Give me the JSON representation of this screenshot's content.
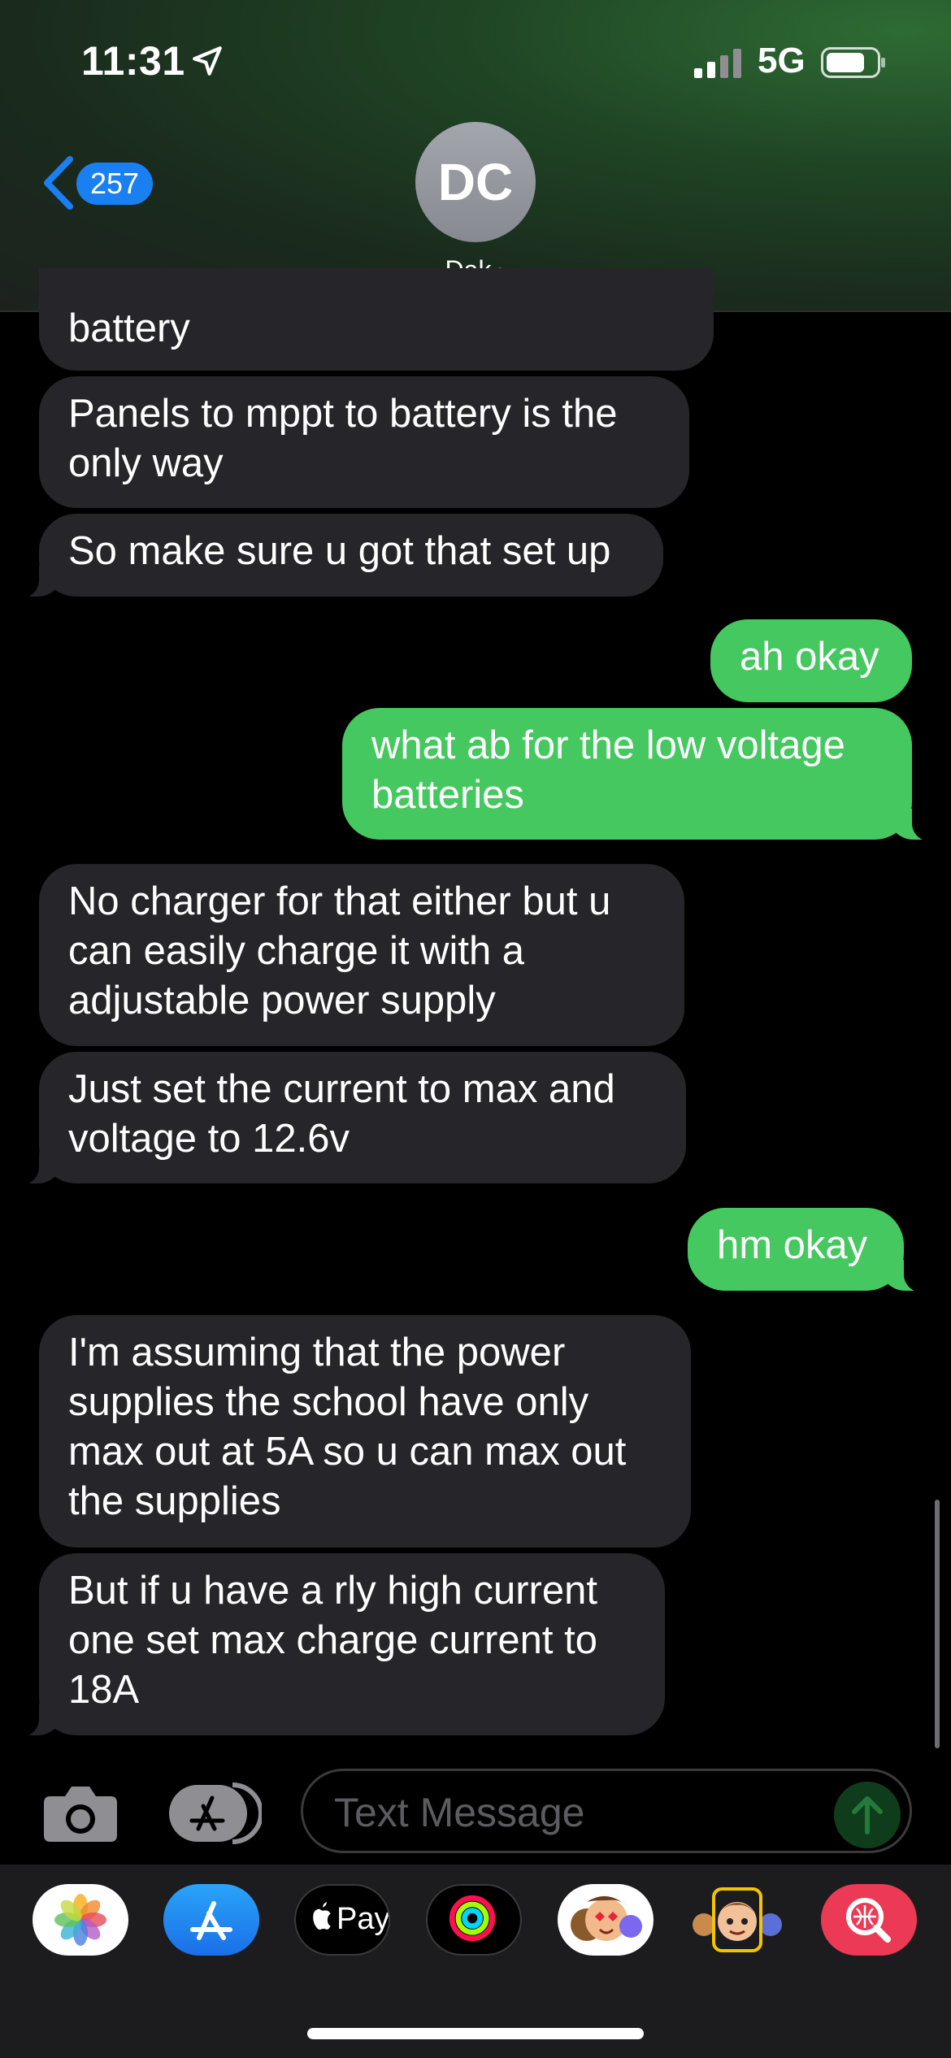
{
  "status_bar": {
    "time": "11:31",
    "network": "5G"
  },
  "header": {
    "back_count": "257",
    "avatar_initials": "DC",
    "contact_name": "Dak"
  },
  "messages": [
    {
      "direction": "incoming",
      "text": "battery"
    },
    {
      "direction": "incoming",
      "text": "Panels to mppt to battery is the\nonly way"
    },
    {
      "direction": "incoming",
      "text": "So make sure u got that set up"
    },
    {
      "direction": "outgoing",
      "text": "ah okay"
    },
    {
      "direction": "outgoing",
      "text": "what ab for the low voltage\nbatteries"
    },
    {
      "direction": "incoming",
      "text": "No charger for that either but u\ncan easily charge it with a\nadjustable power supply"
    },
    {
      "direction": "incoming",
      "text": "Just set the current to max and\nvoltage to 12.6v"
    },
    {
      "direction": "outgoing",
      "text": "hm okay"
    },
    {
      "direction": "incoming",
      "text": "I'm assuming that the power\nsupplies the school have only\nmax out at 5A so u can max out\nthe supplies"
    },
    {
      "direction": "incoming",
      "text": "But if u have a rly high current\none set max charge current to\n18A"
    }
  ],
  "input": {
    "placeholder": "Text Message"
  },
  "app_drawer": {
    "apple_pay_label": "Pay",
    "apps": [
      "photos-icon",
      "app-store-icon",
      "apple-pay-icon",
      "activity-icon",
      "memoji-stickers-icon",
      "memoji-icon",
      "search-images-icon"
    ]
  },
  "colors": {
    "incoming_bubble": "#26262a",
    "outgoing_bubble": "#45c85f",
    "badge": "#1a7ff0"
  }
}
